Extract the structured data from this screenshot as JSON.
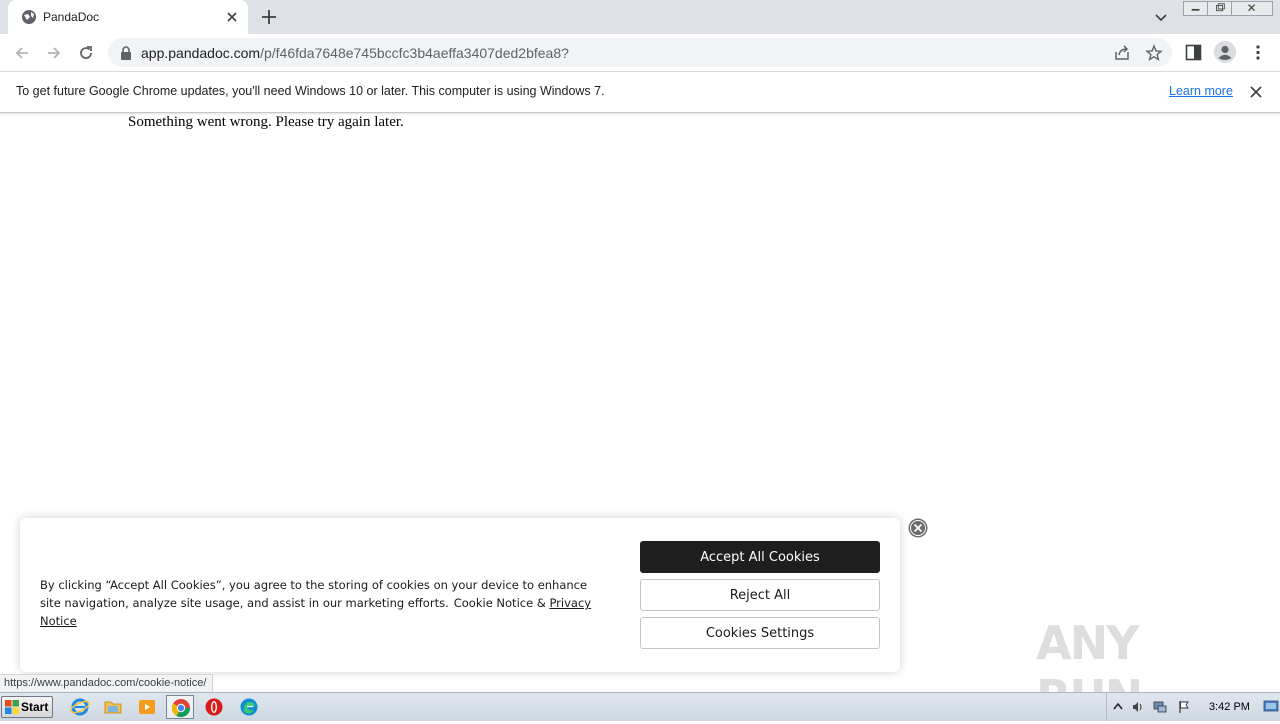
{
  "browser": {
    "tab": {
      "title": "PandaDoc"
    },
    "address": {
      "domain": "app.pandadoc.com",
      "path": "/p/f46fda7648e745bccfc3b4aeffa3407ded2bfea8?"
    },
    "infobar": {
      "message": "To get future Google Chrome updates, you'll need Windows 10 or later. This computer is using Windows 7.",
      "learn_more": "Learn more"
    },
    "status_url": "https://www.pandadoc.com/cookie-notice/"
  },
  "page": {
    "error_message": "Something went wrong. Please try again later."
  },
  "cookie_banner": {
    "text": "By clicking “Accept All Cookies”, you agree to the storing of cookies on your device to enhance site navigation, analyze site usage, and assist in our marketing efforts.",
    "cookie_notice": "Cookie Notice &",
    "privacy_notice": "Privacy Notice",
    "accept_all": "Accept All Cookies",
    "reject_all": "Reject All",
    "settings": "Cookies Settings"
  },
  "watermark": {
    "text": "ANY RUN"
  },
  "taskbar": {
    "start_label": "Start",
    "apps": [
      "internet-explorer-icon",
      "folder-icon",
      "media-player-icon",
      "chrome-icon",
      "opera-icon",
      "edge-icon"
    ],
    "clock": "3:42 PM"
  },
  "colors": {
    "accept_button": "#1e1e1e",
    "link_blue": "#1a73e8",
    "tabstrip": "#dee1e6"
  }
}
